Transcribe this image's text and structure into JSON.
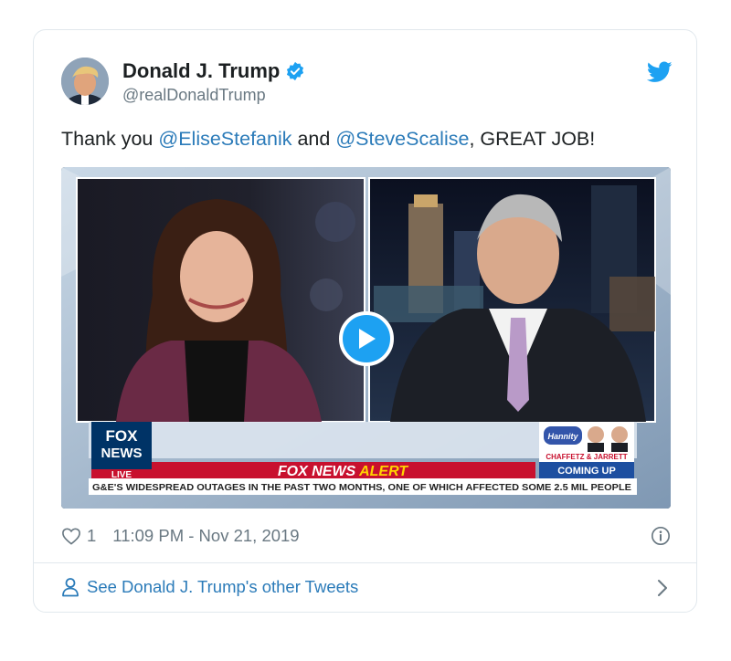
{
  "tweet": {
    "author_name": "Donald J. Trump",
    "handle": "@realDonaldTrump",
    "text_parts": [
      "Thank you ",
      "@EliseStefanik",
      " and ",
      "@SteveScalise",
      ", GREAT JOB!"
    ],
    "like_count": "1",
    "timestamp": "11:09 PM - Nov 21, 2019",
    "footer_link": "See Donald J. Trump's other Tweets"
  },
  "media": {
    "network_logo_line1": "FOX",
    "network_logo_line2": "NEWS",
    "live_label": "LIVE",
    "alert_part1": "FOX NEWS ",
    "alert_part2": "ALERT",
    "ticker": "G&E'S WIDESPREAD OUTAGES IN THE PAST TWO MONTHS, ONE OF WHICH AFFECTED SOME 2.5 MIL PEOPLE",
    "promo_show": "Hannity",
    "promo_names": "CHAFFETZ & JARRETT",
    "promo_status": "COMING UP"
  },
  "colors": {
    "link": "#2b7bb9",
    "muted": "#697882",
    "verified": "#1da1f2",
    "alert_red": "#c8102e",
    "alert_yellow": "#ffd200",
    "fox_blue": "#003366"
  },
  "icons": [
    "verified-badge-icon",
    "twitter-bird-icon",
    "play-icon",
    "heart-icon",
    "info-icon",
    "person-icon",
    "chevron-right-icon"
  ]
}
